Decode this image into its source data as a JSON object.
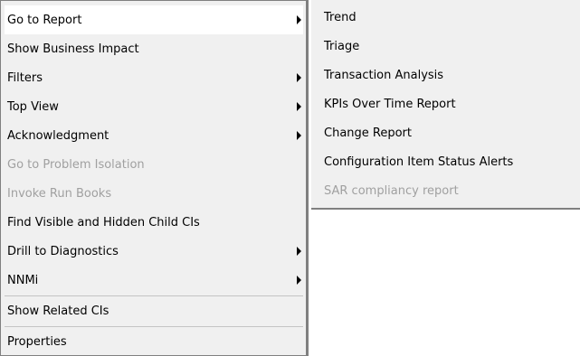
{
  "menu": {
    "items": [
      {
        "label": "Go to Report",
        "submenu": true,
        "disabled": false,
        "active": true
      },
      {
        "label": "Show Business Impact",
        "submenu": false,
        "disabled": false
      },
      {
        "label": "Filters",
        "submenu": true,
        "disabled": false
      },
      {
        "label": "Top View",
        "submenu": true,
        "disabled": false
      },
      {
        "label": "Acknowledgment",
        "submenu": true,
        "disabled": false
      },
      {
        "label": "Go to Problem Isolation",
        "submenu": false,
        "disabled": true
      },
      {
        "label": "Invoke Run Books",
        "submenu": false,
        "disabled": true
      },
      {
        "label": "Find Visible and Hidden Child CIs",
        "submenu": false,
        "disabled": false
      },
      {
        "label": "Drill to Diagnostics",
        "submenu": true,
        "disabled": false
      },
      {
        "label": "NNMi",
        "submenu": true,
        "disabled": false
      },
      {
        "label": "Show Related CIs",
        "submenu": false,
        "disabled": false
      },
      {
        "label": "Properties",
        "submenu": false,
        "disabled": false
      }
    ]
  },
  "submenu": {
    "items": [
      {
        "label": "Trend",
        "disabled": false
      },
      {
        "label": "Triage",
        "disabled": false
      },
      {
        "label": "Transaction Analysis",
        "disabled": false
      },
      {
        "label": "KPIs Over Time Report",
        "disabled": false
      },
      {
        "label": "Change Report",
        "disabled": false
      },
      {
        "label": "Configuration Item Status Alerts",
        "disabled": false
      },
      {
        "label": "SAR compliancy report",
        "disabled": true
      }
    ]
  },
  "colors": {
    "menu_bg": "#f0f0f0",
    "disabled_text": "#a0a0a0",
    "border": "#808080"
  }
}
